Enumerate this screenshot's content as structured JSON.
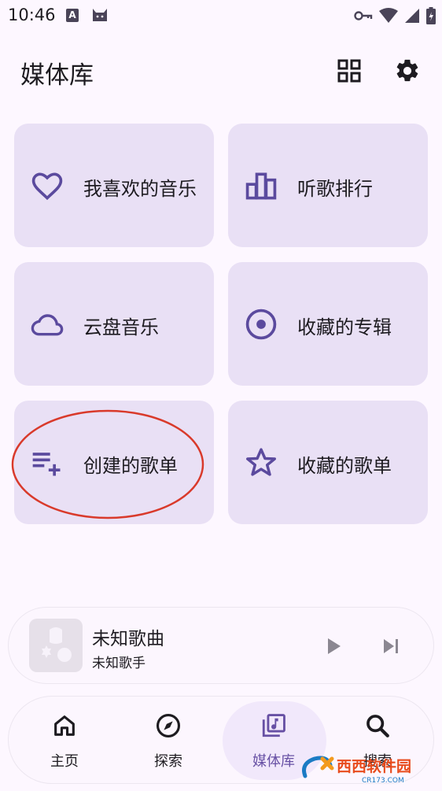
{
  "status_bar": {
    "time": "10:46",
    "notification_icon_letter": "A"
  },
  "header": {
    "title": "媒体库",
    "grid_icon": "grid-view-icon",
    "settings_icon": "gear-icon"
  },
  "cards": [
    {
      "label": "我喜欢的音乐",
      "icon": "heart-icon"
    },
    {
      "label": "听歌排行",
      "icon": "bar-chart-icon"
    },
    {
      "label": "云盘音乐",
      "icon": "cloud-icon"
    },
    {
      "label": "收藏的专辑",
      "icon": "album-disc-icon"
    },
    {
      "label": "创建的歌单",
      "icon": "playlist-add-icon"
    },
    {
      "label": "收藏的歌单",
      "icon": "star-icon"
    }
  ],
  "mini_player": {
    "title": "未知歌曲",
    "artist": "未知歌手"
  },
  "bottom_nav": {
    "items": [
      {
        "label": "主页",
        "icon": "home-icon"
      },
      {
        "label": "探索",
        "icon": "compass-icon"
      },
      {
        "label": "媒体库",
        "icon": "library-music-icon",
        "active": true
      },
      {
        "label": "搜索",
        "icon": "search-icon"
      }
    ]
  },
  "watermark": {
    "text": "西西软件园",
    "subtext": "CR173.COM"
  },
  "colors": {
    "accent": "#6750a4",
    "card_bg": "#e9e0f5",
    "icon": "#5b4a9e",
    "annotation": "#d93a2b"
  }
}
